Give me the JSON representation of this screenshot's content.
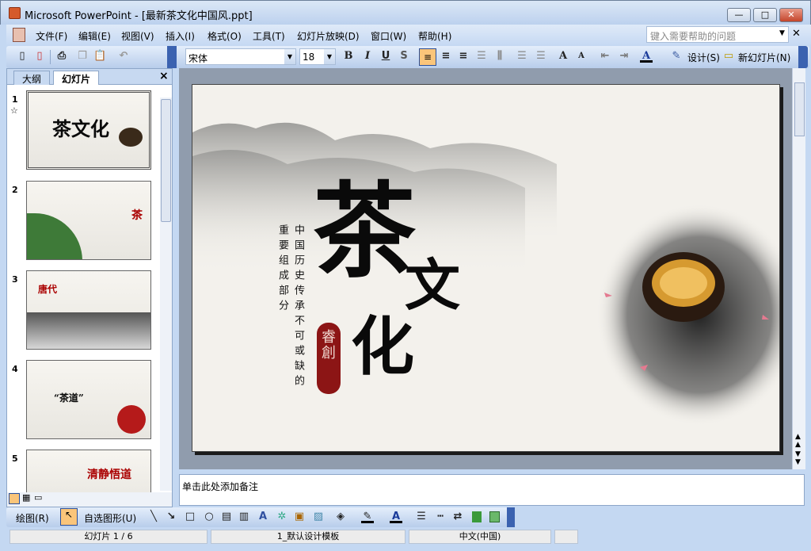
{
  "window": {
    "title": "Microsoft PowerPoint - [最新茶文化中国风.ppt]",
    "minimize": "—",
    "maximize": "□",
    "close": "✕"
  },
  "menu": [
    "文件(F)",
    "编辑(E)",
    "视图(V)",
    "插入(I)",
    "格式(O)",
    "工具(T)",
    "幻灯片放映(D)",
    "窗口(W)",
    "帮助(H)"
  ],
  "help_placeholder": "键入需要帮助的问题",
  "toolbar": {
    "font": "宋体",
    "size": "18",
    "bold": "B",
    "italic": "I",
    "underline": "U",
    "shadow": "S",
    "design": "设计(S)",
    "new_slide": "新幻灯片(N)"
  },
  "panel": {
    "tabs": [
      "大纲",
      "幻灯片"
    ],
    "close": "×"
  },
  "thumbs": [
    {
      "n": "1"
    },
    {
      "n": "2"
    },
    {
      "n": "3"
    },
    {
      "n": "4"
    },
    {
      "n": "5"
    }
  ],
  "slide": {
    "col1": "重要组成部分",
    "col2": "中国历史传承不可或缺的",
    "ch1": "茶",
    "ch2": "文",
    "ch3": "化",
    "seal": "睿創"
  },
  "thumb_text": {
    "t1": "茶文化",
    "t2": "茶",
    "t3": "唐代",
    "t4": "“茶道”",
    "t5": "清静悟道"
  },
  "notes": "单击此处添加备注",
  "drawbar": {
    "draw": "绘图(R)",
    "autoshape": "自选图形(U)"
  },
  "status": {
    "slide": "幻灯片 1 / 6",
    "design": "1_默认设计模板",
    "lang": "中文(中国)"
  }
}
